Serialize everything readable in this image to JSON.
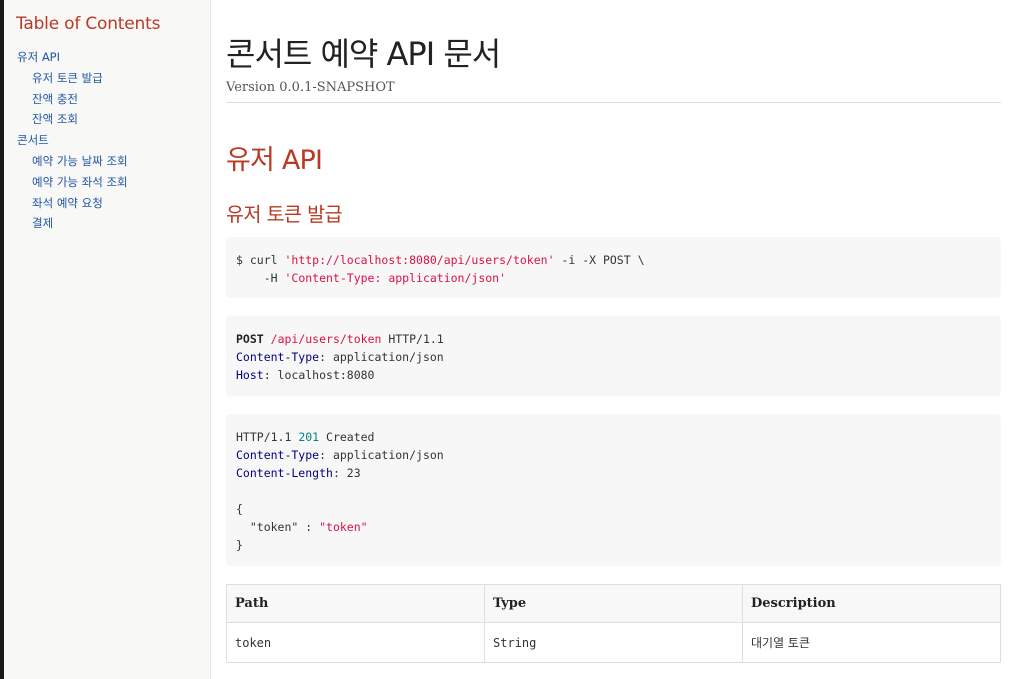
{
  "toc": {
    "title": "Table of Contents",
    "items": [
      {
        "label": "유저 API",
        "level": 1
      },
      {
        "label": "유저 토큰 발급",
        "level": 2
      },
      {
        "label": "잔액 충전",
        "level": 2
      },
      {
        "label": "잔액 조회",
        "level": 2
      },
      {
        "label": "콘서트",
        "level": 1
      },
      {
        "label": "예약 가능 날짜 조회",
        "level": 2
      },
      {
        "label": "예약 가능 좌석 조회",
        "level": 2
      },
      {
        "label": "좌석 예약 요청",
        "level": 2
      },
      {
        "label": "결제",
        "level": 2
      }
    ]
  },
  "doc": {
    "title": "콘서트 예약 API 문서",
    "version": "Version 0.0.1-SNAPSHOT"
  },
  "section": {
    "title": "유저 API",
    "subsection_title": "유저 토큰 발급"
  },
  "curl": {
    "prefix": "$ curl ",
    "url": "'http://localhost:8080/api/users/token'",
    "options": " -i -X POST \\",
    "header_flag": "    -H ",
    "header_value": "'Content-Type: application/json'"
  },
  "request": {
    "method": "POST",
    "path": "/api/users/token",
    "protocol": " HTTP/1.1",
    "headers": [
      {
        "name": "Content-Type",
        "value": ": application/json"
      },
      {
        "name": "Host",
        "value": ": localhost:8080"
      }
    ]
  },
  "response": {
    "protocol": "HTTP/1.1 ",
    "status_code": "201",
    "status_text": " Created",
    "headers": [
      {
        "name": "Content-Type",
        "value": ": application/json"
      },
      {
        "name": "Content-Length",
        "value": ": 23"
      }
    ],
    "body_open": "{",
    "body_key": "  \"token\" : ",
    "body_value": "\"token\"",
    "body_close": "}"
  },
  "fields_table": {
    "headers": [
      "Path",
      "Type",
      "Description"
    ],
    "rows": [
      {
        "path": "token",
        "type": "String",
        "description": "대기열 토큰"
      }
    ]
  }
}
